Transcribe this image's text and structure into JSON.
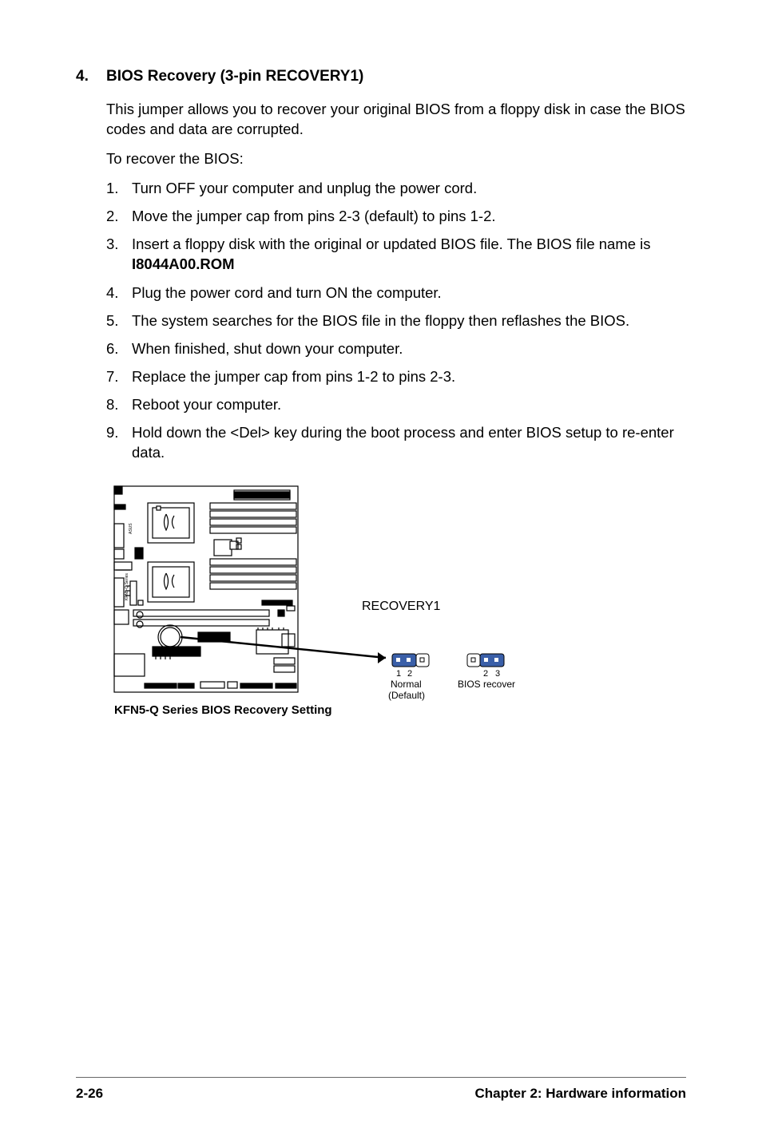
{
  "section": {
    "number": "4.",
    "title": "BIOS Recovery (3-pin RECOVERY1)"
  },
  "intro": "This jumper allows you to recover your original BIOS from a floppy disk in case the BIOS codes and data are corrupted.",
  "subhead": "To recover the BIOS:",
  "steps": [
    {
      "num": "1.",
      "text": "Turn OFF your computer and unplug the power cord."
    },
    {
      "num": "2.",
      "text": "Move the jumper cap from pins 2-3 (default) to pins 1-2."
    },
    {
      "num": "3.",
      "text_prefix": "Insert a floppy disk with the original or updated BIOS file. The BIOS file name is ",
      "bold": "I8044A00.ROM"
    },
    {
      "num": "4.",
      "text": "Plug the power cord and turn ON the computer."
    },
    {
      "num": "5.",
      "text": "The system searches for the BIOS file in the floppy then reflashes the BIOS."
    },
    {
      "num": "6.",
      "text": "When finished, shut down your computer."
    },
    {
      "num": "7.",
      "text": "Replace the jumper cap from pins 1-2 to pins 2-3."
    },
    {
      "num": "8.",
      "text": "Reboot your computer."
    },
    {
      "num": "9.",
      "text": "Hold down the <Del> key during the boot process and enter BIOS setup to re-enter data."
    }
  ],
  "diagram": {
    "caption": "KFN5-Q Series BIOS Recovery Setting",
    "connector_label": "RECOVERY1",
    "jumper1_pins": "1 2",
    "jumper1_label1": "Normal",
    "jumper1_label2": "(Default)",
    "jumper2_pins": "2 3",
    "jumper2_label": "BIOS recover",
    "asus_label": "ASUS"
  },
  "footer": {
    "left": "2-26",
    "right": "Chapter 2: Hardware information"
  }
}
